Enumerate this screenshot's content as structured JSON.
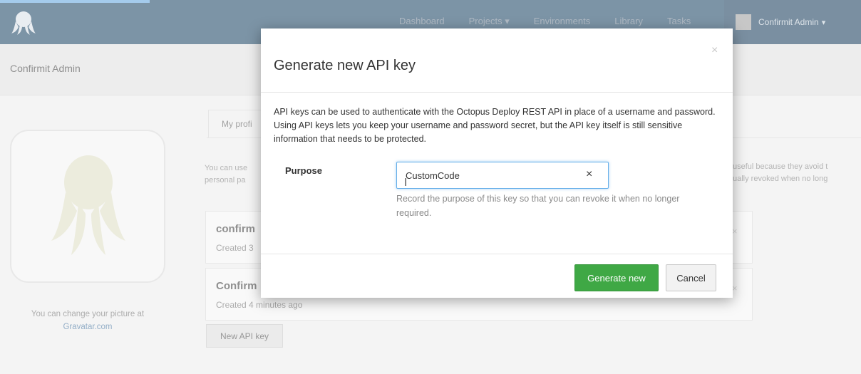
{
  "nav": {
    "links": [
      "Dashboard",
      "Projects",
      "Environments",
      "Library",
      "Tasks"
    ],
    "projects_chevron": "▾",
    "user_name": "Confirmit Admin",
    "user_chevron": "▾"
  },
  "header": {
    "title": "Confirmit Admin"
  },
  "profile": {
    "tab_label": "My profi",
    "description_left": "You can use personal pa",
    "description_right": "useful because they avoid t\nually revoked when no long",
    "gravatar_text": "You can change your picture at",
    "gravatar_link": "Gravatar.com"
  },
  "api_keys": [
    {
      "name": "confirm",
      "created": "Created 3"
    },
    {
      "name": "Confirm",
      "created": "Created 4 minutes ago"
    }
  ],
  "new_api_key_label": "New API key",
  "modal": {
    "title": "Generate new API key",
    "close_glyph": "×",
    "description": "API keys can be used to authenticate with the Octopus Deploy REST API in place of a username and password. Using API keys lets you keep your username and password secret, but the API key itself is still sensitive information that needs to be protected.",
    "purpose_label": "Purpose",
    "purpose_value": "CustomCode",
    "purpose_help": "Record the purpose of this key so that you can revoke it when no longer required.",
    "clear_glyph": "×",
    "generate_label": "Generate new",
    "cancel_label": "Cancel"
  },
  "colors": {
    "nav_bg": "#113c5e",
    "primary_green": "#3fa845",
    "focus_blue": "#66afe9"
  }
}
